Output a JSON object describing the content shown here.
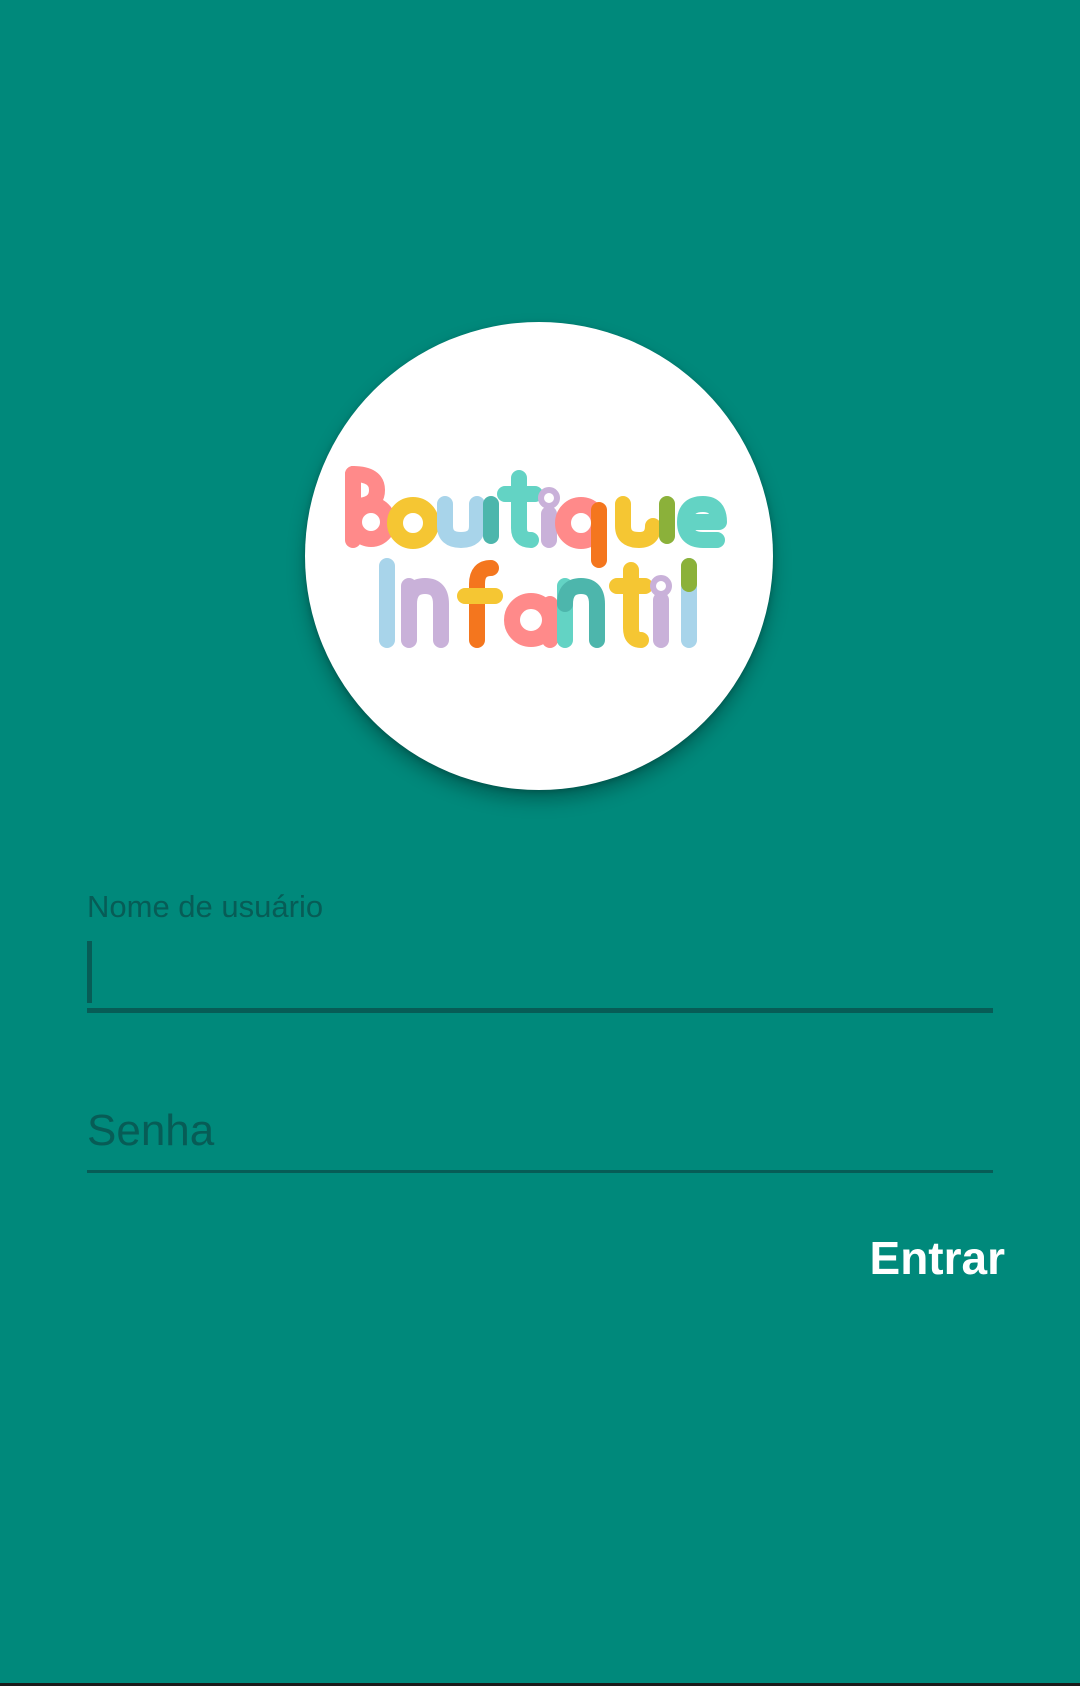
{
  "logo": {
    "line1": "Boutique",
    "line2": "Infantil",
    "letter_colors": [
      "#ff8a8a",
      "#f5c633",
      "#a8d4ea",
      "#4db6ac",
      "#63d3c4",
      "#c9b1d9",
      "#f4761e",
      "#8bb13a"
    ]
  },
  "form": {
    "username": {
      "label": "Nome de usuário",
      "value": ""
    },
    "password": {
      "placeholder": "Senha",
      "value": ""
    },
    "submit_label": "Entrar"
  },
  "colors": {
    "background": "#00897b",
    "field_accent": "#075c56",
    "button_text": "#ffffff"
  }
}
